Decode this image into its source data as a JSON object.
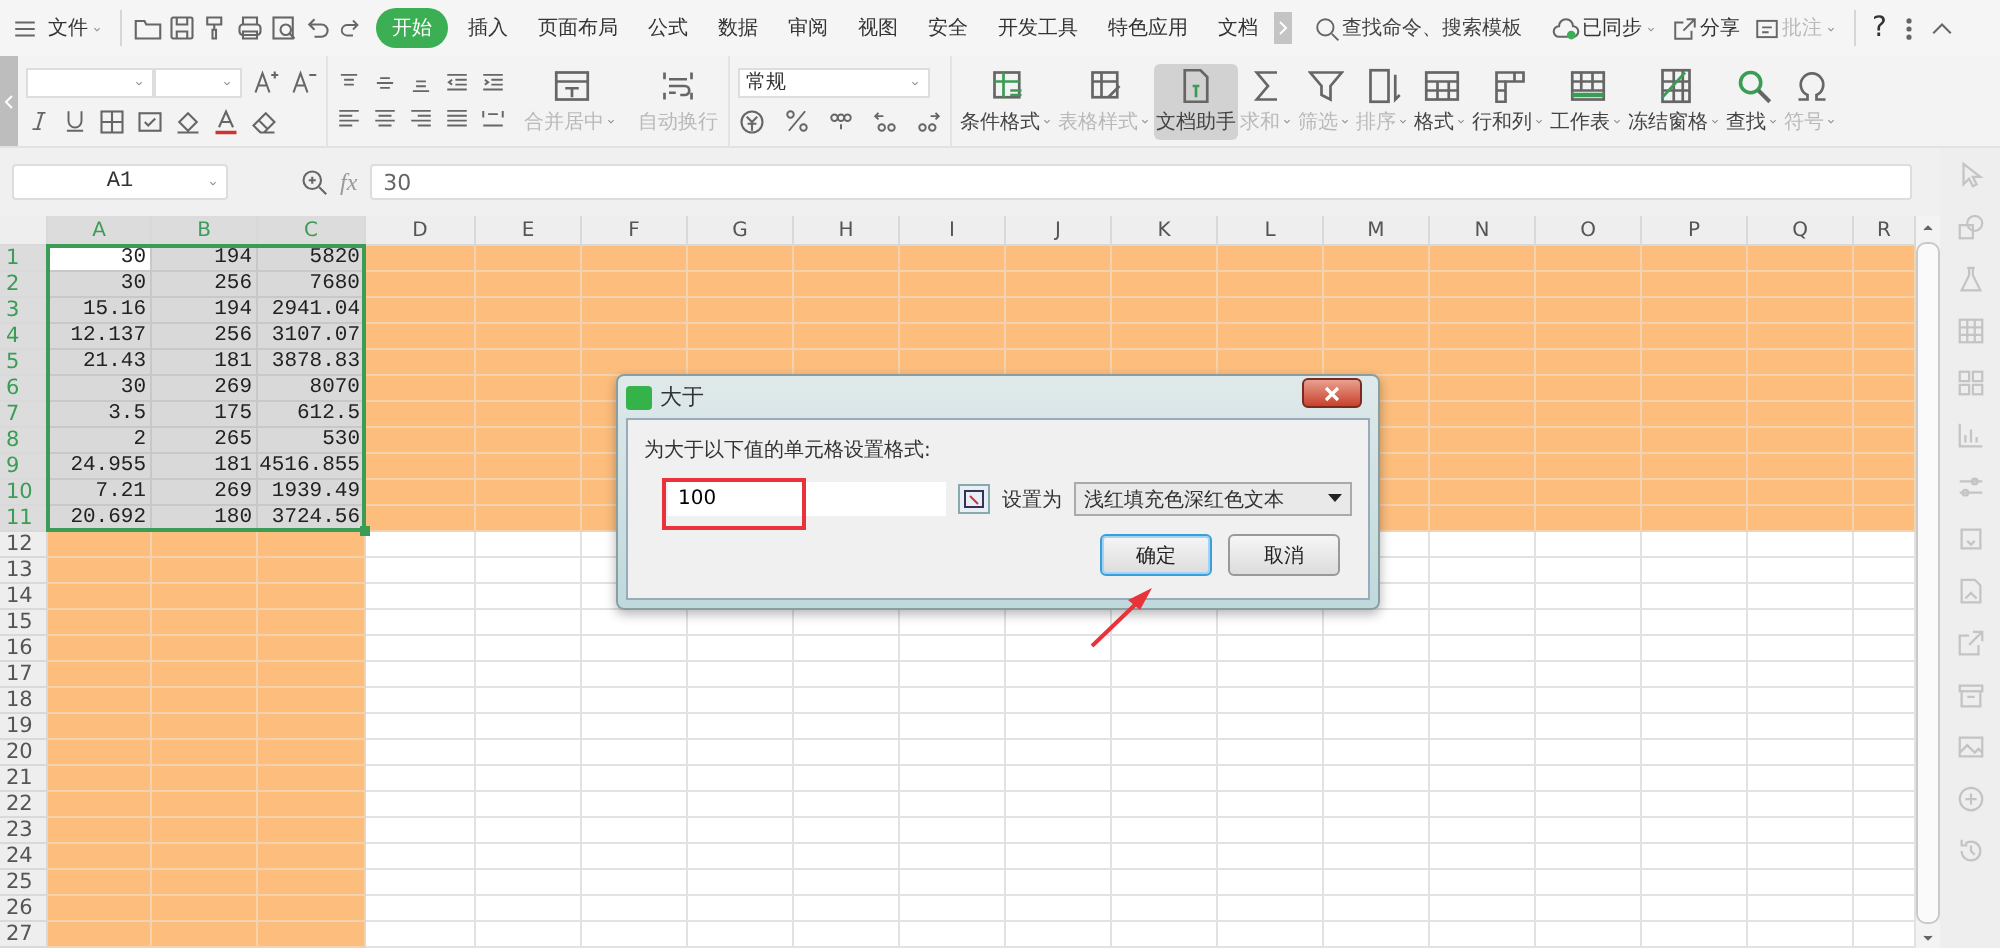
{
  "menu": {
    "file": "文件",
    "tabs": [
      {
        "label": "开始",
        "selected": true
      },
      {
        "label": "插入",
        "selected": false
      },
      {
        "label": "页面布局",
        "selected": false
      },
      {
        "label": "公式",
        "selected": false
      },
      {
        "label": "数据",
        "selected": false
      },
      {
        "label": "审阅",
        "selected": false
      },
      {
        "label": "视图",
        "selected": false
      },
      {
        "label": "安全",
        "selected": false
      },
      {
        "label": "开发工具",
        "selected": false
      },
      {
        "label": "特色应用",
        "selected": false
      },
      {
        "label": "文档",
        "selected": false
      }
    ],
    "search": "查找命令、搜索模板",
    "sync": "已同步",
    "share": "分享",
    "comment": "批注",
    "help": "?"
  },
  "ribbon": {
    "align_buttons": [
      {
        "label": "合并居中",
        "disabled": true,
        "dropdown": true,
        "kind": "merge"
      },
      {
        "label": "自动换行",
        "disabled": true,
        "dropdown": false,
        "kind": "wrap"
      }
    ],
    "number_format": "常规",
    "tools": [
      {
        "label": "条件格式",
        "kind": "conditional",
        "disabled": false,
        "dropdown": true,
        "active": false
      },
      {
        "label": "表格样式",
        "kind": "table-style",
        "disabled": true,
        "dropdown": true,
        "active": false
      },
      {
        "label": "文档助手",
        "kind": "assistant",
        "disabled": false,
        "dropdown": false,
        "active": true
      },
      {
        "label": "求和",
        "kind": "sum",
        "disabled": true,
        "dropdown": true,
        "active": false
      },
      {
        "label": "筛选",
        "kind": "filter",
        "disabled": true,
        "dropdown": true,
        "active": false
      },
      {
        "label": "排序",
        "kind": "sort",
        "disabled": true,
        "dropdown": true,
        "active": false
      },
      {
        "label": "格式",
        "kind": "format",
        "disabled": false,
        "dropdown": true,
        "active": false
      },
      {
        "label": "行和列",
        "kind": "rows",
        "disabled": false,
        "dropdown": true,
        "active": false
      },
      {
        "label": "工作表",
        "kind": "sheet",
        "disabled": false,
        "dropdown": true,
        "active": false
      },
      {
        "label": "冻结窗格",
        "kind": "freeze",
        "disabled": false,
        "dropdown": true,
        "active": false
      },
      {
        "label": "查找",
        "kind": "find",
        "disabled": false,
        "dropdown": true,
        "active": false
      },
      {
        "label": "符号",
        "kind": "symbol",
        "disabled": true,
        "dropdown": true,
        "active": false
      }
    ]
  },
  "formula_bar": {
    "cell": "A1",
    "fx": "fx",
    "value": "30"
  },
  "sheet": {
    "columns": [
      {
        "label": "A",
        "selected": true,
        "highlighted": true
      },
      {
        "label": "B",
        "selected": true,
        "highlighted": true
      },
      {
        "label": "C",
        "selected": true,
        "highlighted": true
      },
      {
        "label": "D",
        "selected": false,
        "highlighted": false
      },
      {
        "label": "E",
        "selected": false,
        "highlighted": false
      },
      {
        "label": "F",
        "selected": false,
        "highlighted": false
      },
      {
        "label": "G",
        "selected": false,
        "highlighted": false
      },
      {
        "label": "H",
        "selected": false,
        "highlighted": false
      },
      {
        "label": "I",
        "selected": false,
        "highlighted": false
      },
      {
        "label": "J",
        "selected": false,
        "highlighted": false
      },
      {
        "label": "K",
        "selected": false,
        "highlighted": false
      },
      {
        "label": "L",
        "selected": false,
        "highlighted": false
      },
      {
        "label": "M",
        "selected": false,
        "highlighted": false
      },
      {
        "label": "N",
        "selected": false,
        "highlighted": false
      },
      {
        "label": "O",
        "selected": false,
        "highlighted": false
      },
      {
        "label": "P",
        "selected": false,
        "highlighted": false
      },
      {
        "label": "Q",
        "selected": false,
        "highlighted": false
      },
      {
        "label": "R",
        "selected": false,
        "highlighted": false
      }
    ],
    "rows": [
      {
        "label": "1",
        "selected": true,
        "highlighted": true,
        "cells": [
          "30",
          "194",
          "5820"
        ]
      },
      {
        "label": "2",
        "selected": true,
        "highlighted": true,
        "cells": [
          "30",
          "256",
          "7680"
        ]
      },
      {
        "label": "3",
        "selected": true,
        "highlighted": true,
        "cells": [
          "15.16",
          "194",
          "2941.04"
        ]
      },
      {
        "label": "4",
        "selected": true,
        "highlighted": true,
        "cells": [
          "12.137",
          "256",
          "3107.07"
        ]
      },
      {
        "label": "5",
        "selected": true,
        "highlighted": true,
        "cells": [
          "21.43",
          "181",
          "3878.83"
        ]
      },
      {
        "label": "6",
        "selected": true,
        "highlighted": true,
        "cells": [
          "30",
          "269",
          "8070"
        ]
      },
      {
        "label": "7",
        "selected": true,
        "highlighted": true,
        "cells": [
          "3.5",
          "175",
          "612.5"
        ]
      },
      {
        "label": "8",
        "selected": true,
        "highlighted": true,
        "cells": [
          "2",
          "265",
          "530"
        ]
      },
      {
        "label": "9",
        "selected": true,
        "highlighted": true,
        "cells": [
          "24.955",
          "181",
          "4516.855"
        ]
      },
      {
        "label": "10",
        "selected": true,
        "highlighted": true,
        "cells": [
          "7.21",
          "269",
          "1939.49"
        ]
      },
      {
        "label": "11",
        "selected": true,
        "highlighted": true,
        "cells": [
          "20.692",
          "180",
          "3724.56"
        ]
      },
      {
        "label": "12",
        "selected": false,
        "highlighted": false
      },
      {
        "label": "13",
        "selected": false,
        "highlighted": false
      },
      {
        "label": "14",
        "selected": false,
        "highlighted": false
      },
      {
        "label": "15",
        "selected": false,
        "highlighted": false
      },
      {
        "label": "16",
        "selected": false,
        "highlighted": false
      },
      {
        "label": "17",
        "selected": false,
        "highlighted": false
      },
      {
        "label": "18",
        "selected": false,
        "highlighted": false
      },
      {
        "label": "19",
        "selected": false,
        "highlighted": false
      },
      {
        "label": "20",
        "selected": false,
        "highlighted": false
      },
      {
        "label": "21",
        "selected": false,
        "highlighted": false
      },
      {
        "label": "22",
        "selected": false,
        "highlighted": false
      },
      {
        "label": "23",
        "selected": false,
        "highlighted": false
      },
      {
        "label": "24",
        "selected": false,
        "highlighted": false
      },
      {
        "label": "25",
        "selected": false,
        "highlighted": false
      },
      {
        "label": "26",
        "selected": false,
        "highlighted": false
      },
      {
        "label": "27",
        "selected": false,
        "highlighted": false
      }
    ]
  },
  "dialog": {
    "title": "大于",
    "prompt": "为大于以下值的单元格设置格式:",
    "value": "100",
    "set_as": "设置为",
    "format": "浅红填充色深红色文本",
    "buttons": [
      {
        "label": "确定",
        "selected": true
      },
      {
        "label": "取消",
        "selected": false
      }
    ]
  }
}
